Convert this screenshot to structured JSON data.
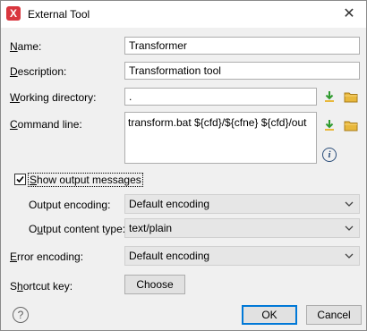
{
  "window": {
    "title": "External Tool",
    "icon": "oxygen-x-icon",
    "close_symbol": "✕"
  },
  "form": {
    "name_label_u": "N",
    "name_label_rest": "ame:",
    "name_value": "Transformer",
    "description_label_u": "D",
    "description_label_rest": "escription:",
    "description_value": "Transformation tool",
    "workdir_label_u": "W",
    "workdir_label_rest": "orking directory:",
    "workdir_value": ".",
    "cmd_label_u": "C",
    "cmd_label_rest": "ommand line:",
    "cmd_value": "transform.bat ${cfd}/${cfne} ${cfd}/out",
    "show_output_label_u": "S",
    "show_output_label_rest": "how output messages",
    "show_output_checked": true,
    "output_encoding_label": "Output encoding:",
    "output_encoding_value": "Default encoding",
    "output_type_label_pre": "O",
    "output_type_label_u": "u",
    "output_type_label_rest": "tput content type:",
    "output_type_value": "text/plain",
    "error_encoding_label_u": "E",
    "error_encoding_label_rest": "rror encoding:",
    "error_encoding_value": "Default encoding",
    "shortcut_label_pre": "S",
    "shortcut_label_u": "h",
    "shortcut_label_rest": "ortcut key:",
    "choose_button": "Choose"
  },
  "footer": {
    "help_symbol": "?",
    "ok_button": "OK",
    "cancel_button": "Cancel"
  },
  "colors": {
    "accent": "#0078d7",
    "app_icon": "#d9363e",
    "folder": "#e8b83c",
    "insert_arrow": "#2e9a2e"
  }
}
